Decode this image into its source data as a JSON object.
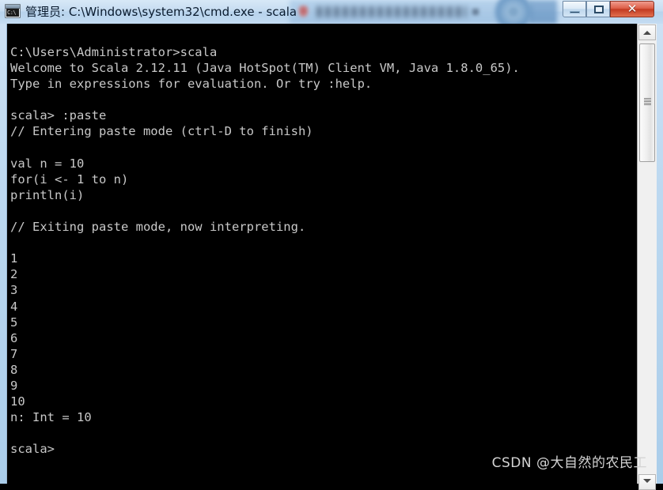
{
  "window": {
    "title": "管理员: C:\\Windows\\system32\\cmd.exe - scala",
    "icon": "console-window-icon",
    "icon_glyph": "C:\\",
    "controls": {
      "minimize_label": "",
      "maximize_label": "",
      "close_label": "✕"
    },
    "titlebar_color": "#c6dcf1",
    "close_button_color": "#c23a22"
  },
  "console": {
    "background_color": "#000000",
    "text_color": "#c8c8c8",
    "lines": [
      "C:\\Users\\Administrator>scala",
      "Welcome to Scala 2.12.11 (Java HotSpot(TM) Client VM, Java 1.8.0_65).",
      "Type in expressions for evaluation. Or try :help.",
      "",
      "scala> :paste",
      "// Entering paste mode (ctrl-D to finish)",
      "",
      "val n = 10",
      "for(i <- 1 to n)",
      "println(i)",
      "",
      "// Exiting paste mode, now interpreting.",
      "",
      "1",
      "2",
      "3",
      "4",
      "5",
      "6",
      "7",
      "8",
      "9",
      "10",
      "n: Int = 10",
      "",
      "scala>"
    ]
  },
  "scrollbar": {
    "up_arrow": "scroll-up-arrow",
    "down_arrow": "scroll-down-arrow",
    "thumb": "scroll-thumb"
  },
  "watermark": {
    "text": "CSDN @大自然的农民工"
  }
}
